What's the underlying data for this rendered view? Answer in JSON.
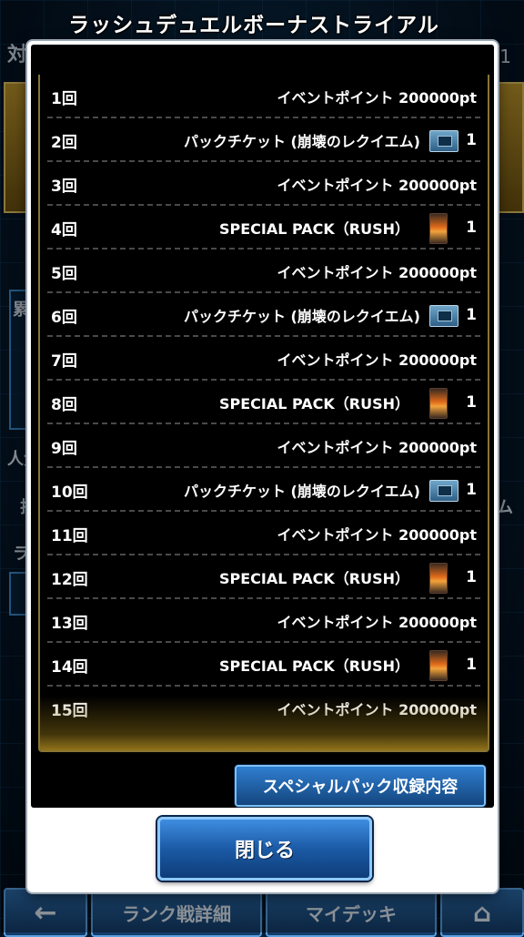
{
  "background": {
    "title": "対戦",
    "corner_number": "1",
    "side_texts": [
      "累",
      "人気",
      "排",
      "ム",
      "ラ"
    ],
    "footer_buttons": [
      "ランク戦詳細",
      "マイデッキ"
    ]
  },
  "dialog": {
    "title": "ラッシュデュエルボーナストライアル",
    "rows": [
      {
        "count": "1回",
        "reward": "イベントポイント 200000pt",
        "qty": "",
        "icon": ""
      },
      {
        "count": "2回",
        "reward": "パックチケット (崩壊のレクイエム)",
        "qty": "1",
        "icon": "ticket-icon"
      },
      {
        "count": "3回",
        "reward": "イベントポイント 200000pt",
        "qty": "",
        "icon": ""
      },
      {
        "count": "4回",
        "reward": "SPECIAL PACK（RUSH）",
        "qty": "1",
        "icon": "pack-icon"
      },
      {
        "count": "5回",
        "reward": "イベントポイント 200000pt",
        "qty": "",
        "icon": ""
      },
      {
        "count": "6回",
        "reward": "パックチケット (崩壊のレクイエム)",
        "qty": "1",
        "icon": "ticket-icon"
      },
      {
        "count": "7回",
        "reward": "イベントポイント 200000pt",
        "qty": "",
        "icon": ""
      },
      {
        "count": "8回",
        "reward": "SPECIAL PACK（RUSH）",
        "qty": "1",
        "icon": "pack-icon"
      },
      {
        "count": "9回",
        "reward": "イベントポイント 200000pt",
        "qty": "",
        "icon": ""
      },
      {
        "count": "10回",
        "reward": "パックチケット (崩壊のレクイエム)",
        "qty": "1",
        "icon": "ticket-icon"
      },
      {
        "count": "11回",
        "reward": "イベントポイント 200000pt",
        "qty": "",
        "icon": ""
      },
      {
        "count": "12回",
        "reward": "SPECIAL PACK（RUSH）",
        "qty": "1",
        "icon": "pack-icon"
      },
      {
        "count": "13回",
        "reward": "イベントポイント 200000pt",
        "qty": "",
        "icon": ""
      },
      {
        "count": "14回",
        "reward": "SPECIAL PACK（RUSH）",
        "qty": "1",
        "icon": "pack-icon"
      },
      {
        "count": "15回",
        "reward": "イベントポイント 200000pt",
        "qty": "",
        "icon": ""
      }
    ],
    "special_pack_button": "スペシャルパック収録内容",
    "close_button": "閉じる"
  }
}
